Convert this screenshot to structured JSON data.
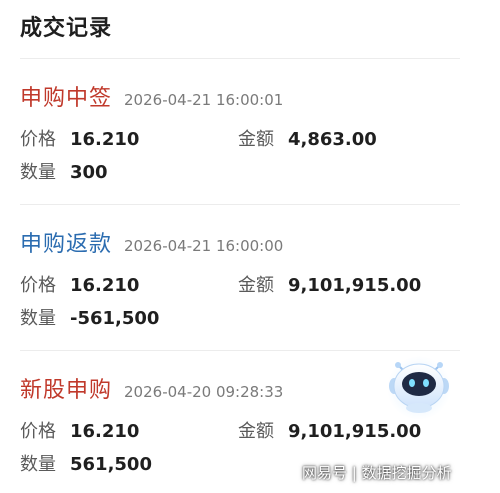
{
  "page_title": "成交记录",
  "labels": {
    "price": "价格",
    "amount": "金额",
    "quantity": "数量"
  },
  "records": [
    {
      "type": "申购中签",
      "type_color": "#c0392b",
      "time": "2026-04-21 16:00:01",
      "price": "16.210",
      "amount": "4,863.00",
      "quantity": "300"
    },
    {
      "type": "申购返款",
      "type_color": "#2b6cb0",
      "time": "2026-04-21 16:00:00",
      "price": "16.210",
      "amount": "9,101,915.00",
      "quantity": "-561,500"
    },
    {
      "type": "新股申购",
      "type_color": "#c0392b",
      "time": "2026-04-20 09:28:33",
      "price": "16.210",
      "amount": "9,101,915.00",
      "quantity": "561,500"
    }
  ],
  "watermark": "网易号 | 数据挖掘分析",
  "icons": {
    "assistant": "robot-assistant-icon"
  }
}
